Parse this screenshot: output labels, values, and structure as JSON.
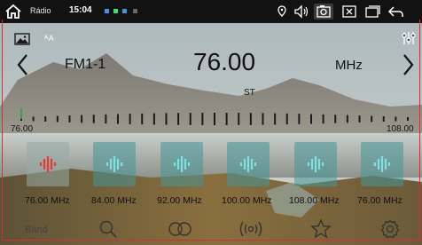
{
  "status_bar": {
    "app_name": "Rádio",
    "time": "15:04",
    "indicator_colors": [
      "#4a90e2",
      "#3ddc84",
      "#4a90e2",
      "#888888"
    ],
    "icons": [
      "home-icon",
      "location-icon",
      "volume-icon",
      "screenshot-icon",
      "close-window-icon",
      "window-icon",
      "back-icon"
    ]
  },
  "toolbar": {
    "image_icon": "image-icon",
    "font_size_label": "ᴬA",
    "eq_icon": "equalizer-icon"
  },
  "tuner": {
    "band": "FM1-1",
    "frequency": "76.00",
    "unit": "MHz",
    "stereo": "ST",
    "scale_min": "76.00",
    "scale_max": "108.00",
    "current_position_fraction": 0.0
  },
  "presets": [
    {
      "label": "76.00 MHz",
      "active": true
    },
    {
      "label": "84.00 MHz",
      "active": false
    },
    {
      "label": "92.00 MHz",
      "active": false
    },
    {
      "label": "100.00 MHz",
      "active": false
    },
    {
      "label": "108.00 MHz",
      "active": false
    },
    {
      "label": "76.00 MHz",
      "active": false
    }
  ],
  "bottom_bar": {
    "band_label": "Band",
    "icons": [
      "search-icon",
      "stereo-icon",
      "broadcast-icon",
      "favorite-icon",
      "settings-icon"
    ]
  },
  "colors": {
    "accent_red": "#e53935",
    "active_teal": "#7fe0e0",
    "frame_red": "#d03038"
  }
}
